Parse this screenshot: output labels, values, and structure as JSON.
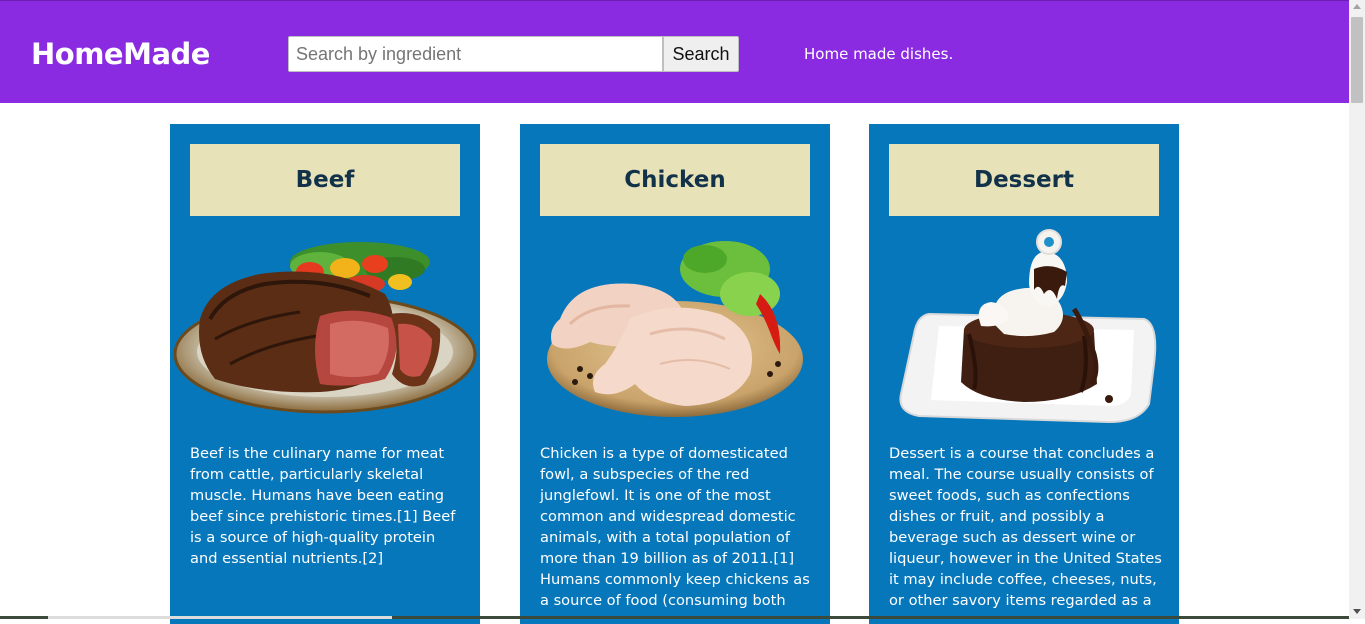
{
  "header": {
    "logo": "HomeMade",
    "search_placeholder": "Search by ingredient",
    "search_value": "",
    "search_button": "Search",
    "tagline": "Home made dishes.",
    "background_color": "#8a2be2"
  },
  "cards": [
    {
      "title": "Beef",
      "image_icon": "beef-steak-image",
      "description": "Beef is the culinary name for meat from cattle, particularly skeletal muscle. Humans have been eating beef since prehistoric times.[1] Beef is a source of high-quality protein and essential nutrients.[2]"
    },
    {
      "title": "Chicken",
      "image_icon": "raw-chicken-image",
      "description": "Chicken is a type of domesticated fowl, a subspecies of the red junglefowl. It is one of the most common and widespread domestic animals, with a total population of more than 19 billion as of 2011.[1] Humans commonly keep chickens as a source of food (consuming both"
    },
    {
      "title": "Dessert",
      "image_icon": "chocolate-cake-image",
      "description": "Dessert is a course that concludes a meal. The course usually consists of sweet foods, such as confections dishes or fruit, and possibly a beverage such as dessert wine or liqueur, however in the United States it may include coffee, cheeses, nuts, or other savory items regarded as a"
    }
  ],
  "colors": {
    "card_background": "#0777bb",
    "title_box": "#e8e2b9",
    "title_text": "#12324a"
  }
}
